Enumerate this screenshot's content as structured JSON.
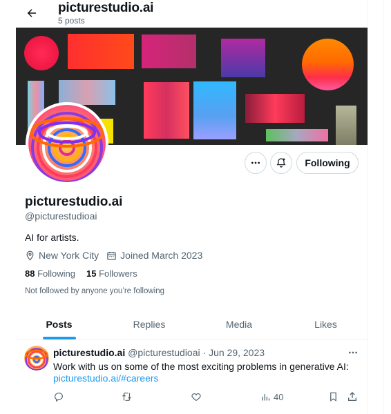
{
  "header": {
    "title": "picturestudio.ai",
    "post_count": "5 posts"
  },
  "profile": {
    "name": "picturestudio.ai",
    "handle": "@picturestudioai",
    "bio": "AI for artists.",
    "location": "New York City",
    "joined": "Joined March 2023",
    "following_count": "88",
    "following_label": "Following",
    "followers_count": "15",
    "followers_label": "Followers",
    "not_followed_text": "Not followed by anyone you’re following"
  },
  "actions": {
    "follow_button_label": "Following",
    "more_icon": "more-horizontal-icon",
    "notify_icon": "bell-plus-icon"
  },
  "tabs": [
    {
      "label": "Posts",
      "active": true
    },
    {
      "label": "Replies",
      "active": false
    },
    {
      "label": "Media",
      "active": false
    },
    {
      "label": "Likes",
      "active": false
    }
  ],
  "tweet": {
    "author_name": "picturestudio.ai",
    "author_handle": "@picturestudioai",
    "separator": "·",
    "date": "Jun 29, 2023",
    "text": "Work with us on some of the most exciting problems in generative AI:",
    "link": "picturestudio.ai/#careers",
    "views": "40"
  },
  "colors": {
    "accent": "#1d9bf0",
    "text_primary": "#0f1419",
    "text_secondary": "#536471",
    "border": "#cfd9de",
    "banner_bg": "#262626"
  }
}
